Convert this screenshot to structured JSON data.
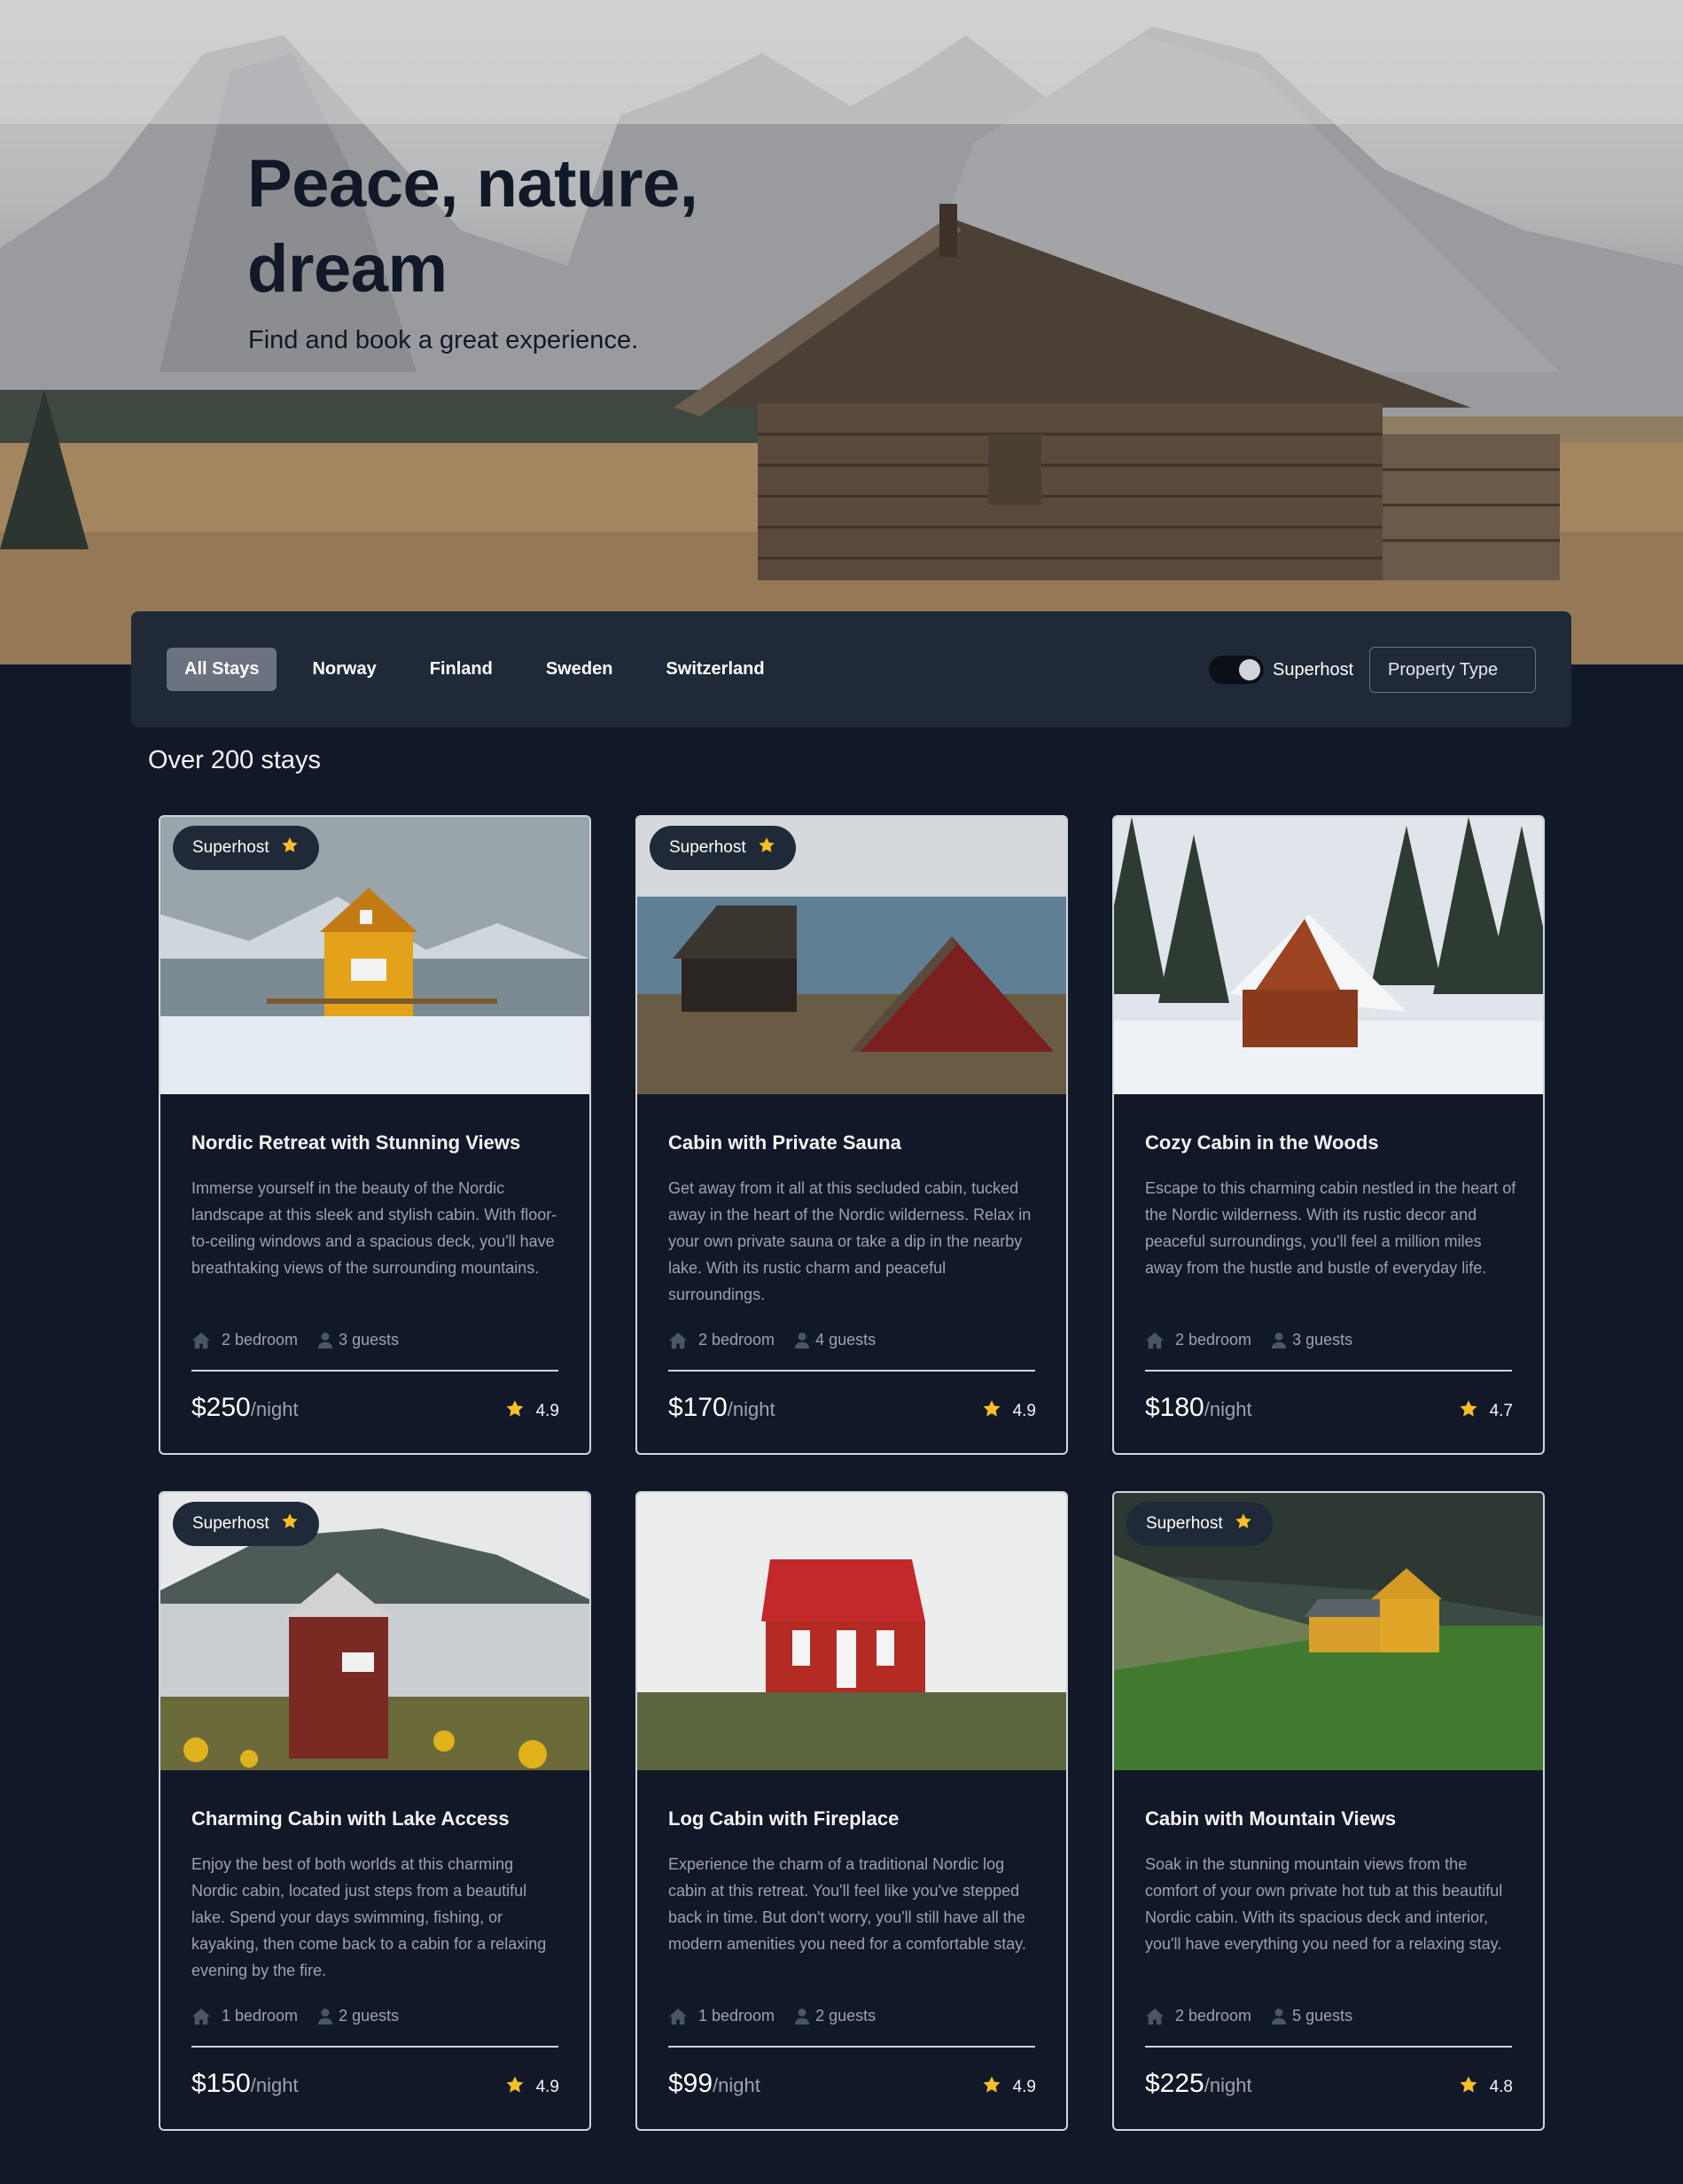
{
  "hero": {
    "title": "Peace, nature, dream",
    "subtitle": "Find and book a great experience."
  },
  "filters": {
    "tabs": [
      "All Stays",
      "Norway",
      "Finland",
      "Sweden",
      "Switzerland"
    ],
    "active_tab": "All Stays",
    "superhost_toggle": {
      "label": "Superhost",
      "checked": true
    },
    "property_type": {
      "label": "Property Type"
    }
  },
  "results": {
    "count_label": "Over 200 stays"
  },
  "colors": {
    "background": "#111827",
    "panel": "#1f2937",
    "star": "#fbbf24",
    "muted_text": "#9ca3af"
  },
  "icons": {
    "home": "home-icon",
    "guest": "user-icon",
    "star": "star-icon"
  },
  "listings": [
    {
      "superhost": true,
      "superhost_label": "Superhost",
      "title": "Nordic Retreat with Stunning Views",
      "description": "Immerse yourself in the beauty of the Nordic landscape at this sleek and stylish cabin. With floor-to-ceiling windows and a spacious deck, you'll have breathtaking views of the surrounding mountains.",
      "bedrooms": "2 bedroom",
      "guests": "3 guests",
      "price": "$250",
      "price_unit": "/night",
      "rating": "4.9"
    },
    {
      "superhost": true,
      "superhost_label": "Superhost",
      "title": "Cabin with Private Sauna",
      "description": "Get away from it all at this secluded cabin, tucked away in the heart of the Nordic wilderness. Relax in your own private sauna or take a dip in the nearby lake. With its rustic charm and peaceful surroundings.",
      "bedrooms": "2 bedroom",
      "guests": "4 guests",
      "price": "$170",
      "price_unit": "/night",
      "rating": "4.9"
    },
    {
      "superhost": false,
      "superhost_label": "",
      "title": "Cozy Cabin in the Woods",
      "description": "Escape to this charming cabin nestled in the heart of the Nordic wilderness. With its rustic decor and peaceful surroundings, you'll feel a million miles away from the hustle and bustle of everyday life.",
      "bedrooms": "2 bedroom",
      "guests": "3 guests",
      "price": "$180",
      "price_unit": "/night",
      "rating": "4.7"
    },
    {
      "superhost": true,
      "superhost_label": "Superhost",
      "title": "Charming Cabin with Lake Access",
      "description": "Enjoy the best of both worlds at this charming Nordic cabin, located just steps from a beautiful lake. Spend your days swimming, fishing, or kayaking, then come back to a cabin for a relaxing evening by the fire.",
      "bedrooms": "1 bedroom",
      "guests": "2 guests",
      "price": "$150",
      "price_unit": "/night",
      "rating": "4.9"
    },
    {
      "superhost": false,
      "superhost_label": "",
      "title": "Log Cabin with Fireplace",
      "description": "Experience the charm of a traditional Nordic log cabin at this retreat. You'll feel like you've stepped back in time. But don't worry, you'll still have all the modern amenities you need for a comfortable stay.",
      "bedrooms": "1 bedroom",
      "guests": "2 guests",
      "price": "$99",
      "price_unit": "/night",
      "rating": "4.9"
    },
    {
      "superhost": true,
      "superhost_label": "Superhost",
      "title": "Cabin with Mountain Views",
      "description": "Soak in the stunning mountain views from the comfort of your own private hot tub at this beautiful Nordic cabin. With its spacious deck and interior, you'll have everything you need for a relaxing stay.",
      "bedrooms": "2 bedroom",
      "guests": "5 guests",
      "price": "$225",
      "price_unit": "/night",
      "rating": "4.8"
    }
  ]
}
